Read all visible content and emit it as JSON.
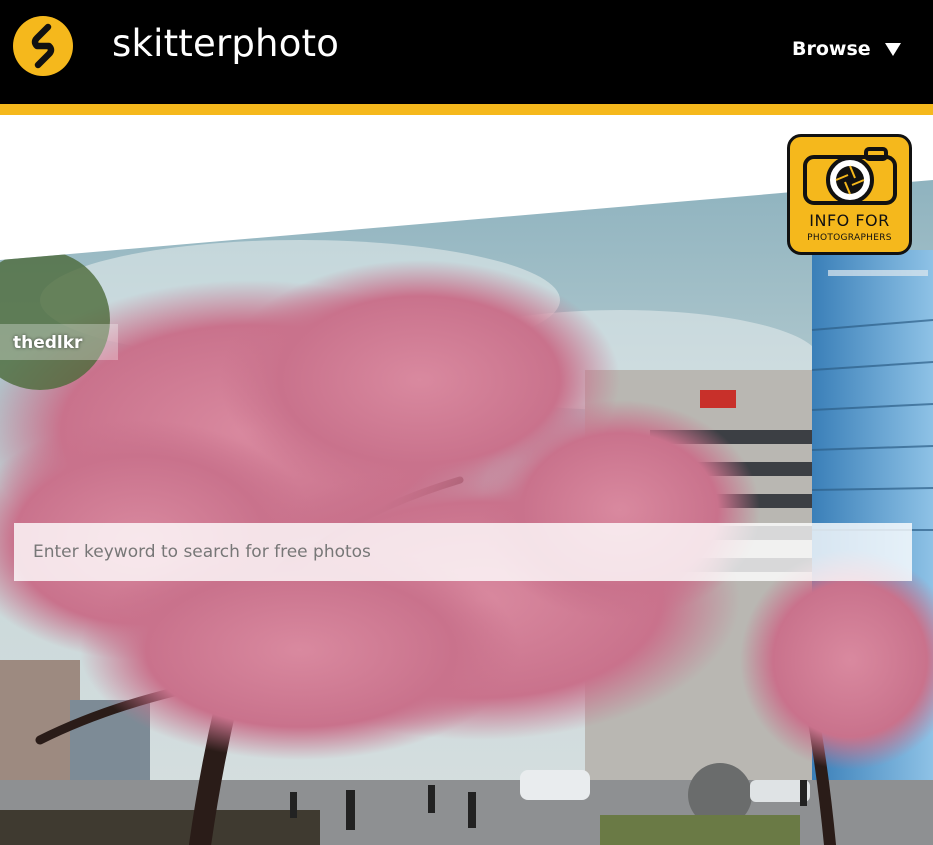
{
  "header": {
    "brand": "skitterphoto",
    "browse_label": "Browse",
    "logo_icon": "skitterphoto-logo-icon",
    "caret_icon": "caret-down-icon"
  },
  "badge": {
    "line1": "INFO FOR",
    "line2": "PHOTOGRAPHERS",
    "icon": "camera-icon"
  },
  "hero": {
    "photo_credit": "thedlkr"
  },
  "search": {
    "placeholder": "Enter keyword to search for free photos",
    "value": ""
  },
  "colors": {
    "header_bg": "#000000",
    "accent": "#f5b81c",
    "page_bg": "#ffffff"
  }
}
